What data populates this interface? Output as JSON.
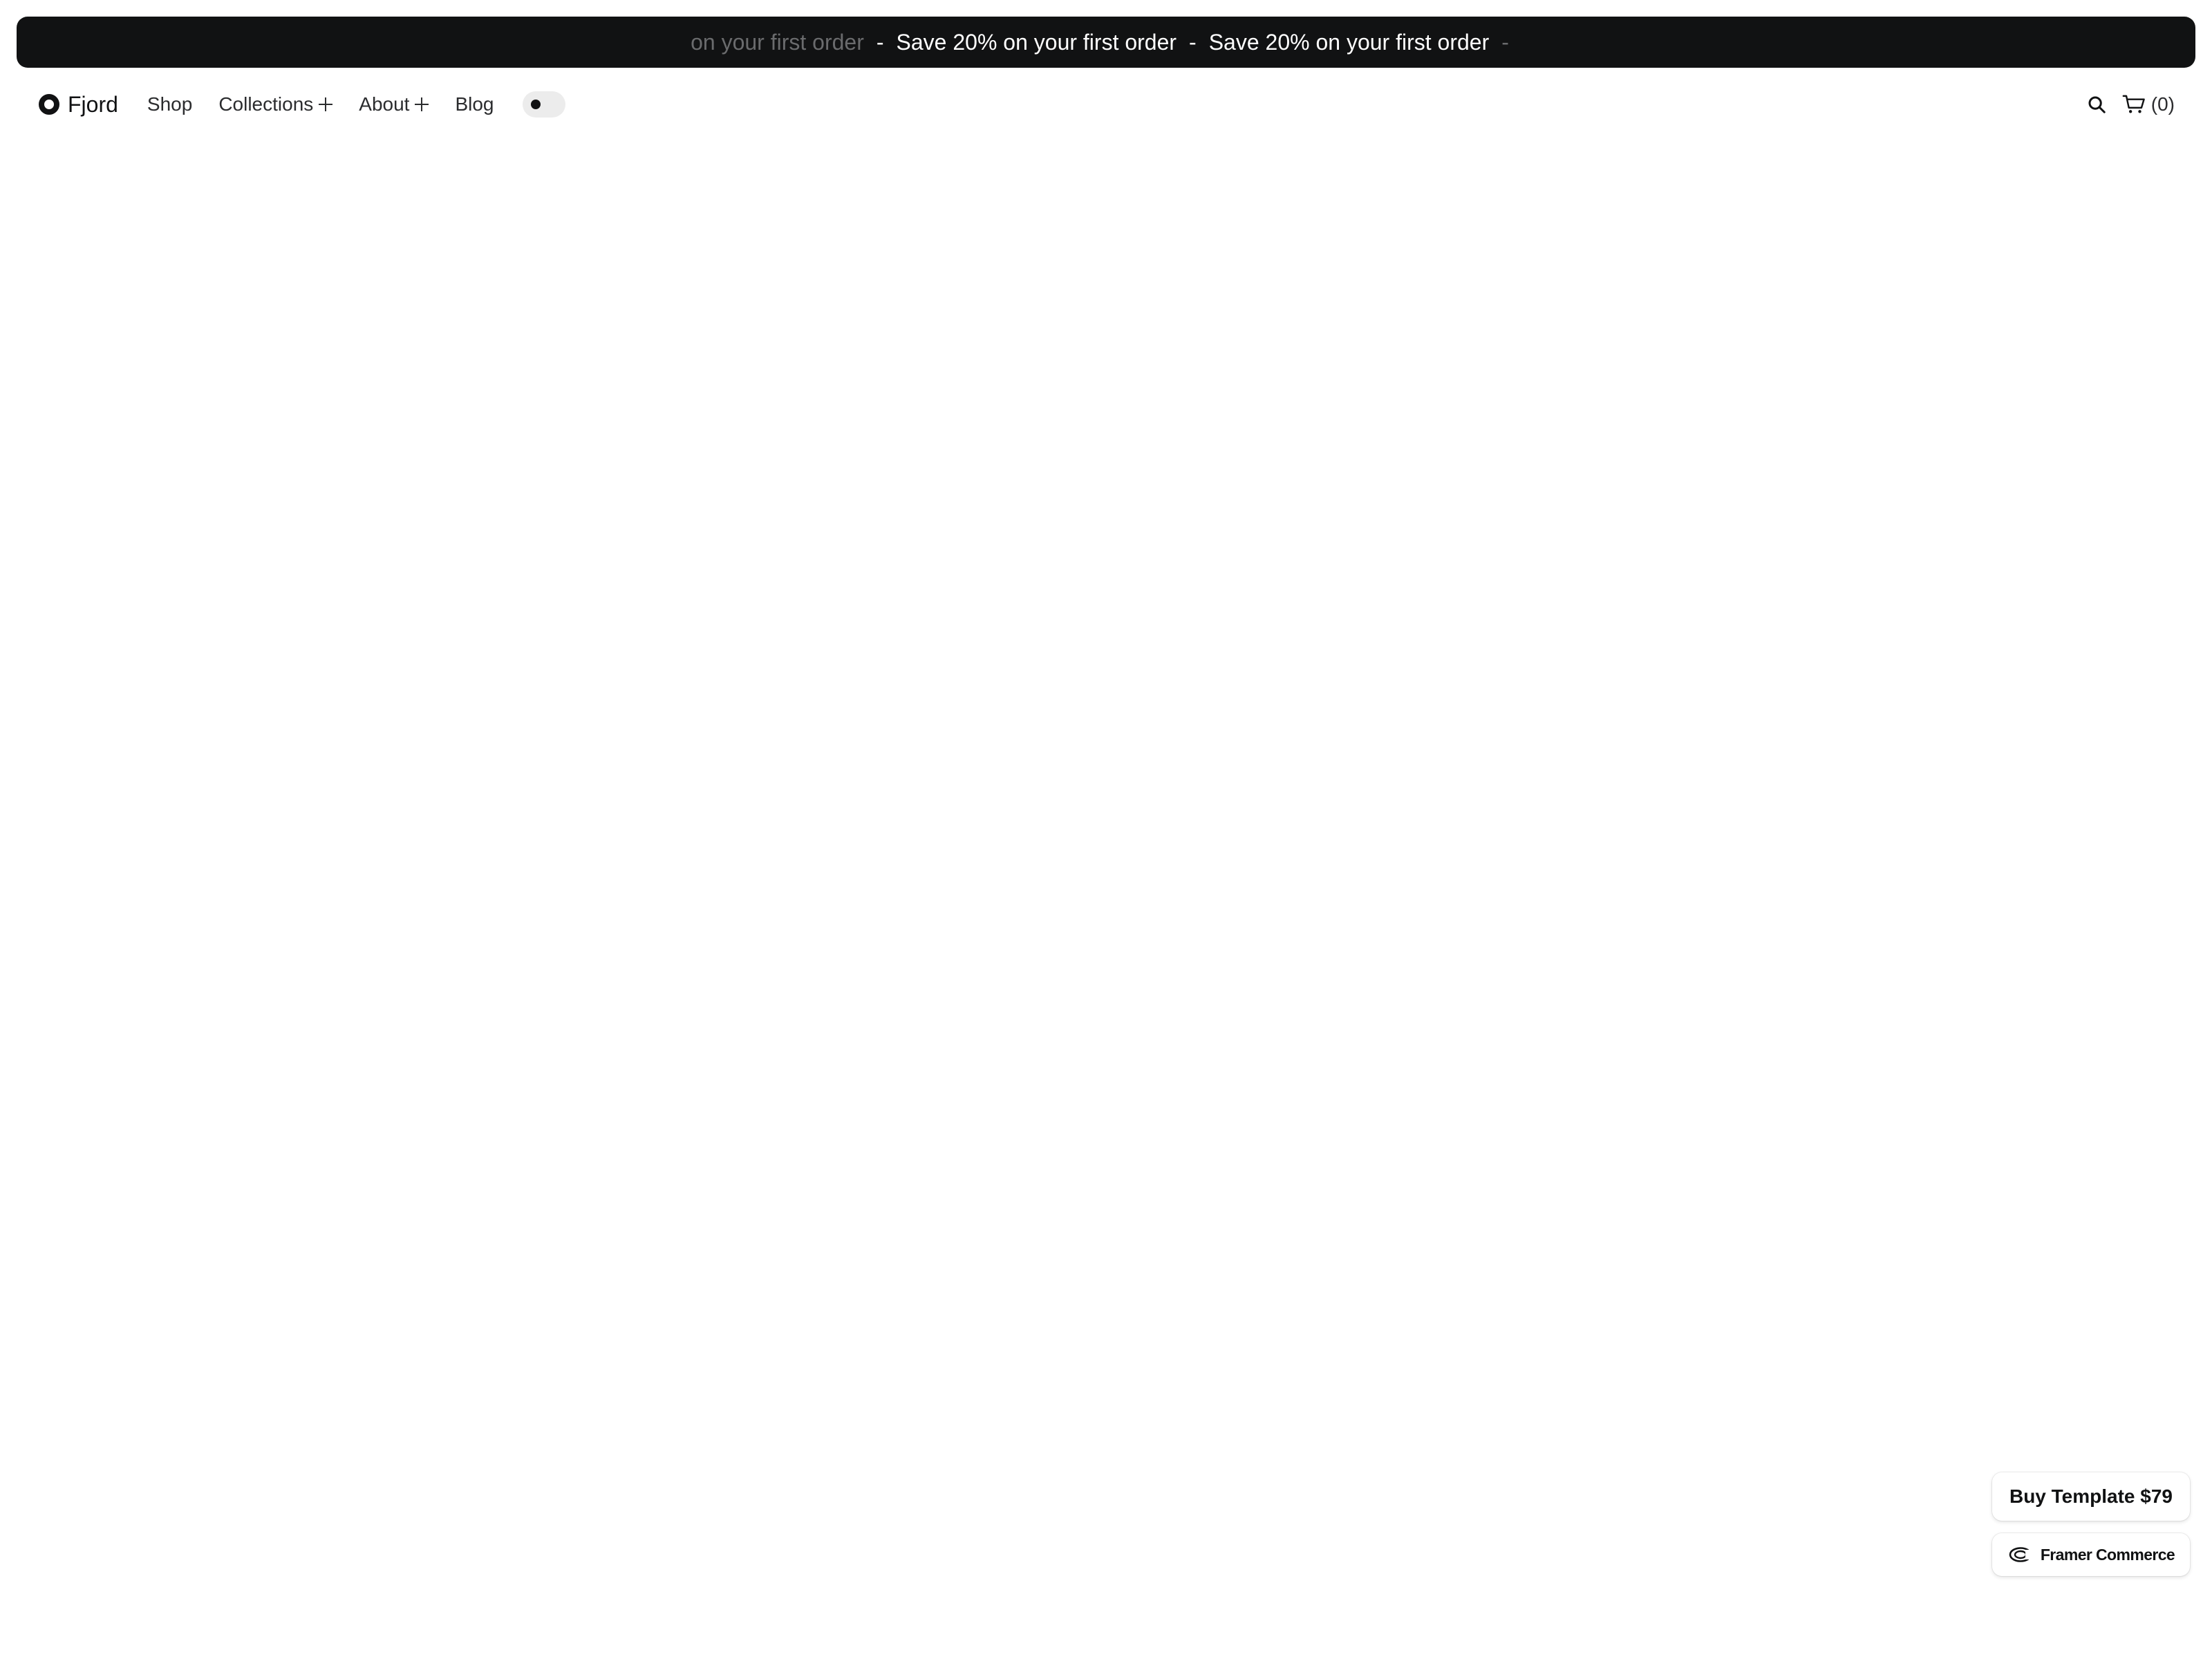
{
  "announcement": {
    "lead_fragment": "on your first order",
    "message": "Save 20% on your first order",
    "trailing_fragment": "Save 20% on your first order",
    "separator": "-"
  },
  "header": {
    "brand": "Fjord",
    "nav": [
      {
        "label": "Shop"
      },
      {
        "label": "Collections"
      },
      {
        "label": "About"
      },
      {
        "label": "Blog"
      }
    ],
    "icons": {
      "brand_mark": "ring-logo-icon",
      "toggle": "theme-toggle",
      "search": "search-icon",
      "cart": "cart-icon"
    },
    "cart_count": "(0)"
  },
  "floating": {
    "buy_label": "Buy Template $79",
    "badge_label": "Framer Commerce",
    "badge_icon": "framer-commerce-logo-icon"
  },
  "colors": {
    "bar_background": "#111213",
    "text_dark": "#111213",
    "background": "#ffffff"
  }
}
